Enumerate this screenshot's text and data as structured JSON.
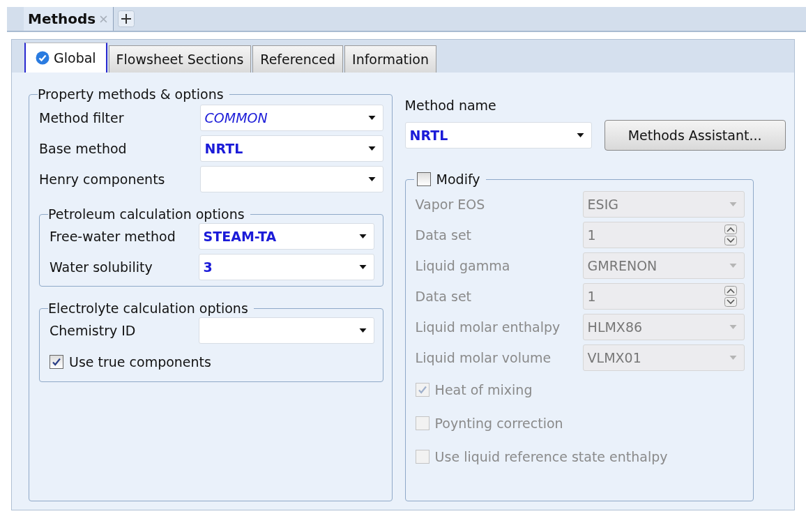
{
  "document_tabs": [
    {
      "label": "Methods",
      "selected": true
    }
  ],
  "tabs": [
    {
      "label": "Global",
      "selected": true,
      "complete": true
    },
    {
      "label": "Flowsheet Sections",
      "selected": false,
      "complete": false
    },
    {
      "label": "Referenced",
      "selected": false,
      "complete": false
    },
    {
      "label": "Information",
      "selected": false,
      "complete": false
    }
  ],
  "property_methods": {
    "title": "Property methods & options",
    "fields": [
      {
        "label": "Method filter",
        "value": "COMMON",
        "italic": true,
        "bold": false
      },
      {
        "label": "Base method",
        "value": "NRTL",
        "italic": false,
        "bold": true
      },
      {
        "label": "Henry components"
      }
    ],
    "groups": [
      {
        "title": "Petroleum calculation options",
        "fields": [
          {
            "label": "Free-water method",
            "value": "STEAM-TA",
            "italic": false,
            "bold": true
          },
          {
            "label": "Water solubility",
            "value": "3",
            "italic": false,
            "bold": true
          }
        ]
      },
      {
        "title": "Electrolyte calculation options",
        "fields": [
          {
            "label": "Chemistry ID"
          }
        ],
        "options": [
          {
            "label": "Use true components",
            "checked": true,
            "disabled": false
          }
        ]
      }
    ]
  },
  "method_name": {
    "label": "Method name",
    "value": "NRTL",
    "button": "Methods Assistant..."
  },
  "modify": {
    "label": "Modify",
    "checked": false,
    "fields": [
      {
        "label": "Vapor EOS",
        "value": "ESIG",
        "kind": "dropdown",
        "disabled": true
      },
      {
        "label": "Data set",
        "value": "1",
        "kind": "spinner",
        "disabled": true
      },
      {
        "label": "Liquid gamma",
        "value": "GMRENON",
        "kind": "dropdown",
        "disabled": true
      },
      {
        "label": "Data set",
        "value": "1",
        "kind": "spinner",
        "disabled": true
      },
      {
        "label": "Liquid molar enthalpy",
        "value": "HLMX86",
        "kind": "dropdown",
        "disabled": true
      },
      {
        "label": "Liquid molar volume",
        "value": "VLMX01",
        "kind": "dropdown",
        "disabled": true
      }
    ],
    "options": [
      {
        "label": "Heat of mixing",
        "checked": true,
        "disabled": true
      },
      {
        "label": "Poynting correction",
        "checked": false,
        "disabled": true
      },
      {
        "label": "Use liquid reference state enthalpy",
        "checked": false,
        "disabled": true
      }
    ]
  }
}
